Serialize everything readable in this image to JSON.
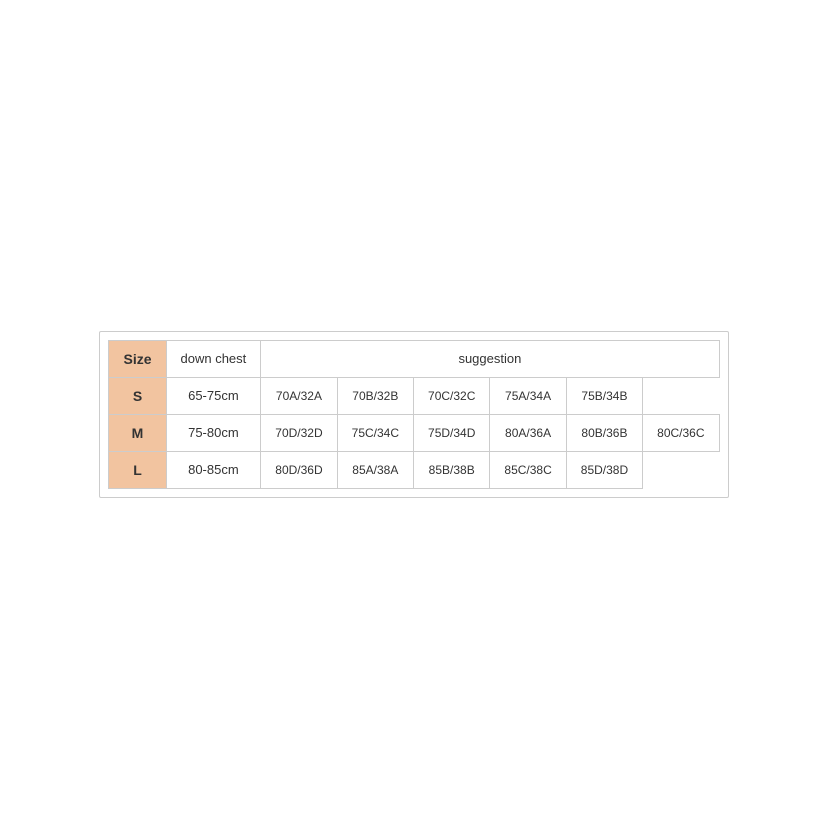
{
  "table": {
    "headers": {
      "size": "Size",
      "down_chest": "down chest",
      "suggestion": "suggestion"
    },
    "rows": [
      {
        "size": "S",
        "measurement": "65-75cm",
        "suggestions": [
          "70A/32A",
          "70B/32B",
          "70C/32C",
          "75A/34A",
          "75B/34B"
        ]
      },
      {
        "size": "M",
        "measurement": "75-80cm",
        "suggestions": [
          "70D/32D",
          "75C/34C",
          "75D/34D",
          "80A/36A",
          "80B/36B",
          "80C/36C"
        ]
      },
      {
        "size": "L",
        "measurement": "80-85cm",
        "suggestions": [
          "80D/36D",
          "85A/38A",
          "85B/38B",
          "85C/38C",
          "85D/38D"
        ]
      }
    ]
  }
}
